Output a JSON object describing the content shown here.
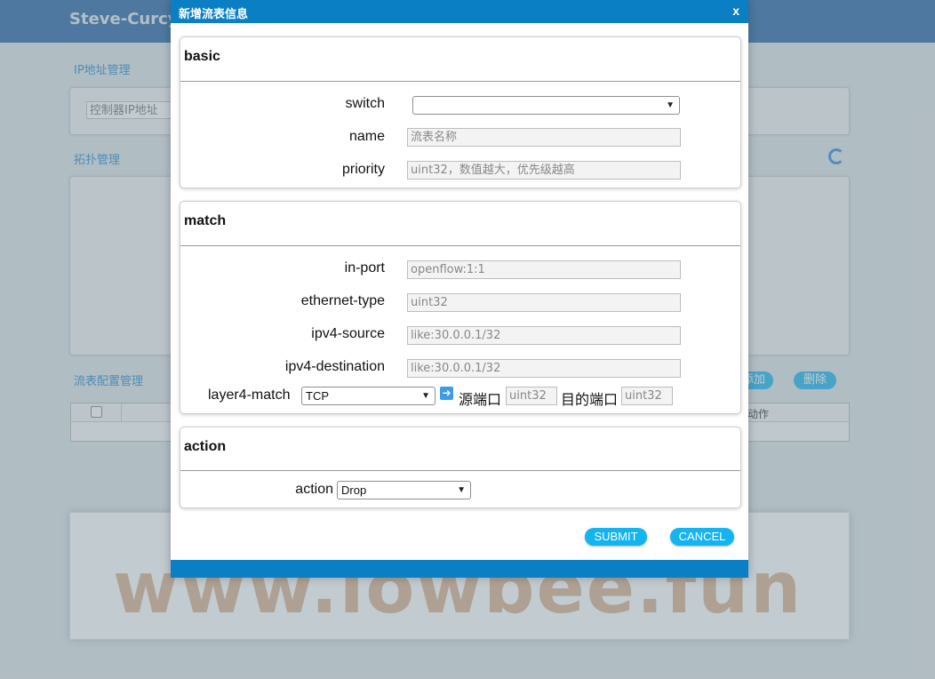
{
  "app": {
    "brand": "Steve-Curcy"
  },
  "background": {
    "ip_section_label": "IP地址管理",
    "controller_ip_placeholder": "控制器IP地址",
    "topology_label": "拓扑管理",
    "flow_config_label": "流表配置管理",
    "add_button": "添加",
    "delete_button": "删除",
    "table_header_action": "动作",
    "watermark": "www.lowbee.fun"
  },
  "dialog": {
    "title": "新增流表信息",
    "close": "x",
    "basic": {
      "title": "basic",
      "switch_label": "switch",
      "switch_value": "",
      "name_label": "name",
      "name_placeholder": "流表名称",
      "priority_label": "priority",
      "priority_placeholder": "uint32，数值越大，优先级越高"
    },
    "match": {
      "title": "match",
      "in_port_label": "in-port",
      "in_port_placeholder": "openflow:1:1",
      "ethernet_type_label": "ethernet-type",
      "ethernet_type_placeholder": "uint32",
      "ipv4_source_label": "ipv4-source",
      "ipv4_source_placeholder": "like:30.0.0.1/32",
      "ipv4_destination_label": "ipv4-destination",
      "ipv4_destination_placeholder": "like:30.0.0.1/32",
      "layer4_match_label": "layer4-match",
      "layer4_match_value": "TCP",
      "source_port_label": "源端口",
      "source_port_placeholder": "uint32",
      "dest_port_label": "目的端口",
      "dest_port_placeholder": "uint32"
    },
    "action": {
      "title": "action",
      "action_label": "action",
      "action_value": "Drop"
    },
    "submit": "SUBMIT",
    "cancel": "CANCEL"
  }
}
